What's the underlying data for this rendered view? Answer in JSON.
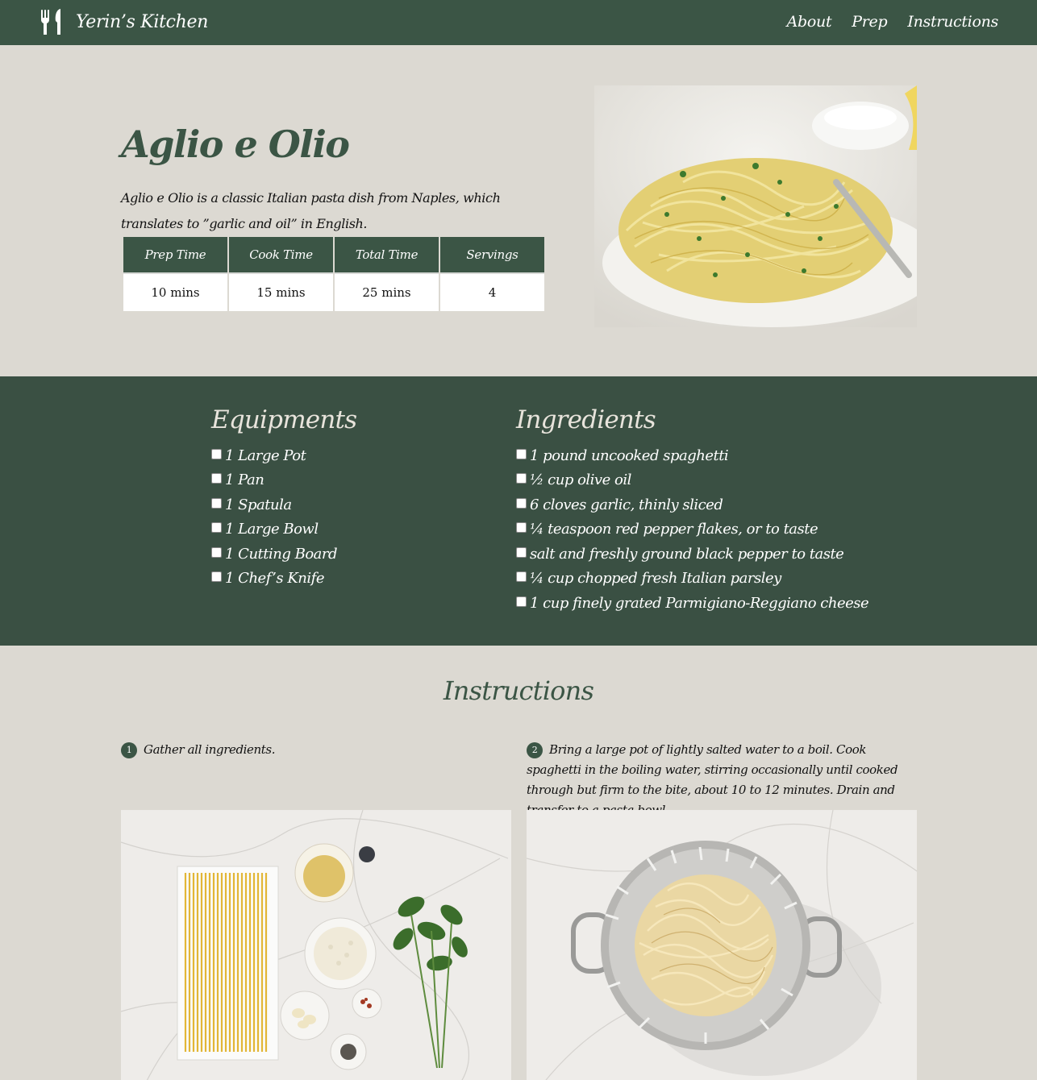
{
  "nav": {
    "brand": "Yerin’s Kitchen",
    "logo_icon": "utensils-icon",
    "links": [
      "About",
      "Prep",
      "Instructions"
    ]
  },
  "hero": {
    "title": "Aglio e Olio",
    "description": "Aglio e Olio is a classic Italian pasta dish from Naples, which translates to ”garlic and oil” in English.",
    "table": {
      "headers": [
        "Prep Time",
        "Cook Time",
        "Total Time",
        "Servings"
      ],
      "values": [
        "10 mins",
        "15 mins",
        "25 mins",
        "4"
      ]
    },
    "photo": "pasta-plate-photo"
  },
  "equipments": {
    "title": "Equipments",
    "items": [
      "1 Large Pot",
      "1 Pan",
      "1 Spatula",
      "1 Large Bowl",
      "1 Cutting Board",
      "1 Chef’s Knife"
    ]
  },
  "ingredients": {
    "title": "Ingredients",
    "items": [
      "1 pound uncooked spaghetti",
      "½ cup olive oil",
      "6 cloves garlic, thinly sliced",
      "¼ teaspoon red pepper flakes, or to taste",
      "salt and freshly ground black pepper to taste",
      "¼ cup chopped fresh Italian parsley",
      "1 cup finely grated Parmigiano-Reggiano cheese"
    ]
  },
  "instructions": {
    "title": "Instructions",
    "steps": [
      {
        "num": "1",
        "text": "Gather all ingredients."
      },
      {
        "num": "2",
        "text": "Bring a large pot of lightly salted water to a boil. Cook spaghetti in the boiling water, stirring occasionally until cooked through but firm to the bite, about 10 to 12 minutes. Drain and transfer to a pasta bowl."
      }
    ]
  },
  "colors": {
    "primary_green": "#3b5545",
    "background": "#dcd9d2"
  }
}
